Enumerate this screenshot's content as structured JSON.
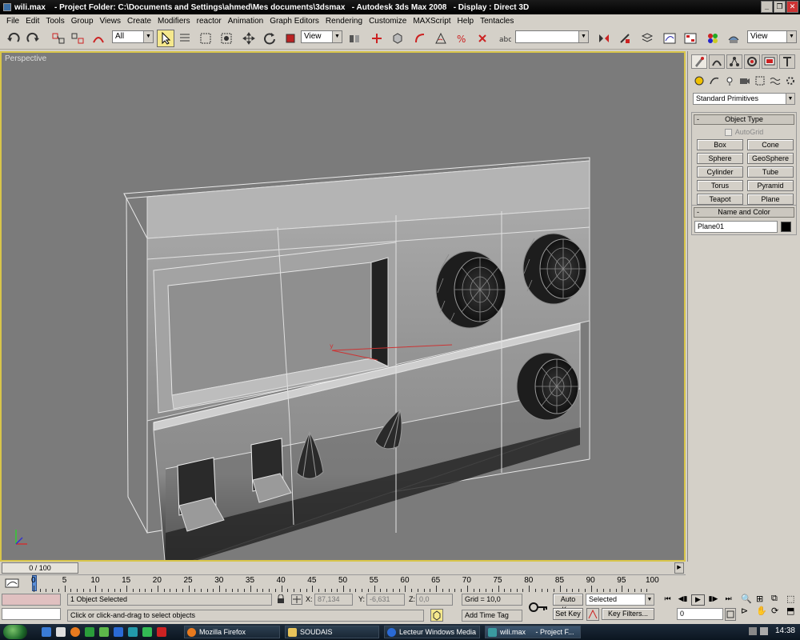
{
  "window": {
    "title_file": "wili.max",
    "title_project": "- Project Folder: C:\\Documents and Settings\\ahmed\\Mes documents\\3dsmax",
    "title_app": "- Autodesk 3ds Max 2008",
    "title_display": "- Display : Direct 3D"
  },
  "menu": [
    "File",
    "Edit",
    "Tools",
    "Group",
    "Views",
    "Create",
    "Modifiers",
    "reactor",
    "Animation",
    "Graph Editors",
    "Rendering",
    "Customize",
    "MAXScript",
    "Help",
    "Tentacles"
  ],
  "toolbar": {
    "selection_filter": "All",
    "ref_coord": "View",
    "named_selection": "",
    "viewport_render": "View"
  },
  "viewport": {
    "label": "Perspective",
    "axis_y": "y"
  },
  "command_panel": {
    "category": "Standard Primitives",
    "object_type_title": "Object Type",
    "autogrid": "AutoGrid",
    "primitives": [
      "Box",
      "Cone",
      "Sphere",
      "GeoSphere",
      "Cylinder",
      "Tube",
      "Torus",
      "Pyramid",
      "Teapot",
      "Plane"
    ],
    "name_color_title": "Name and Color",
    "object_name": "Plane01",
    "object_color": "#000000"
  },
  "timeline": {
    "slider_label": "0 / 100",
    "ticks": [
      "0",
      "5",
      "10",
      "15",
      "20",
      "25",
      "30",
      "35",
      "40",
      "45",
      "50",
      "55",
      "60",
      "65",
      "70",
      "75",
      "80",
      "85",
      "90",
      "95",
      "100"
    ]
  },
  "status": {
    "selection_info": "1 Object Selected",
    "prompt": "Click or click-and-drag to select objects",
    "x_label": "X:",
    "x_value": "87,134",
    "y_label": "Y:",
    "y_value": "-6,631",
    "z_label": "Z:",
    "z_value": "0,0",
    "grid": "Grid = 10,0",
    "add_time_tag": "Add Time Tag",
    "auto_key": "Auto Key",
    "set_key": "Set Key",
    "key_mode": "Selected",
    "key_filters": "Key Filters...",
    "frame": "0"
  },
  "taskbar": {
    "tasks": [
      "Mozilla Firefox",
      "SOUDAIS",
      "Lecteur Windows Media",
      "wili.max     - Project F..."
    ],
    "clock": "14:38"
  }
}
